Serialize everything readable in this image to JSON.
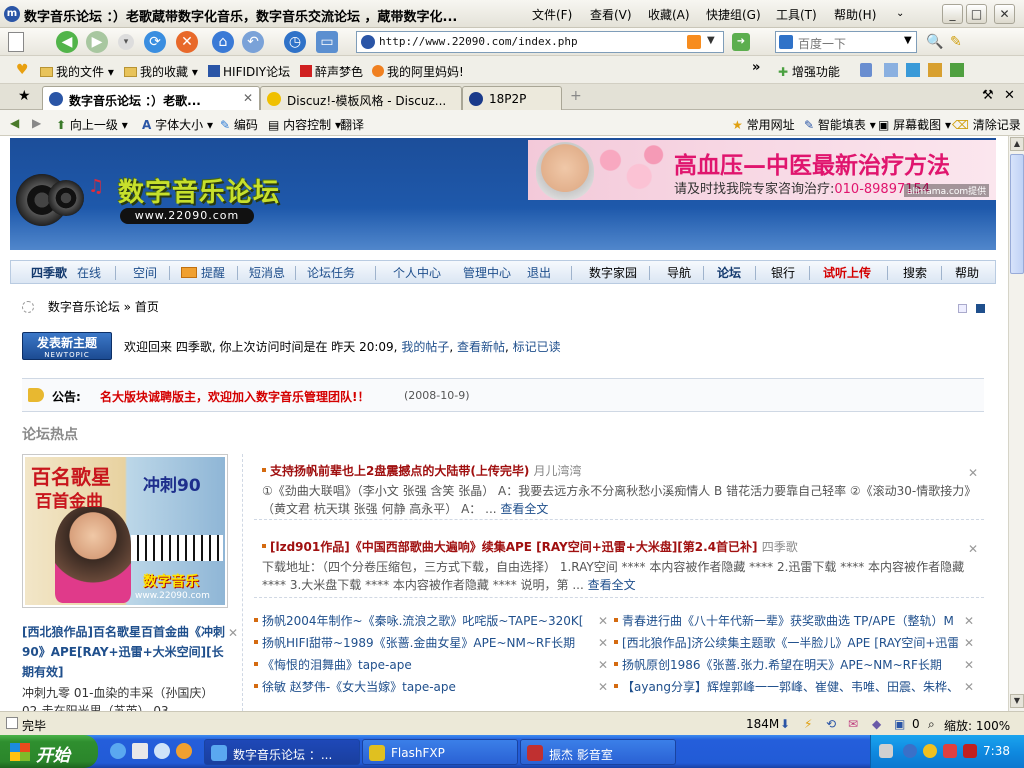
{
  "window": {
    "title": "数字音乐论坛 ：）老歌蔵带数字化音乐，数字音乐交流论坛 ，蔵带数字化...",
    "menus": [
      "文件(F)",
      "查看(V)",
      "收藏(A)",
      "快捷组(G)",
      "工具(T)",
      "帮助(H)"
    ],
    "controls": {
      "minimize": "_",
      "maximize": "□",
      "close": "✕"
    }
  },
  "toolbar": {
    "address": "http://www.22090.com/index.php",
    "search_placeholder": "百度一下"
  },
  "favorites": {
    "items": [
      "我的文件",
      "我的收藏",
      "HIFIDIY论坛",
      "醉声梦色",
      "我的阿里妈妈!"
    ],
    "right": [
      "增强功能"
    ]
  },
  "tabs": [
    {
      "label": "数字音乐论坛 ：）老歌...",
      "active": true
    },
    {
      "label": "Discuz!-模板风格 - Discuz...",
      "active": false
    },
    {
      "label": "18P2P",
      "active": false
    }
  ],
  "assist": {
    "left": [
      "向上一级",
      "字体大小",
      "编码",
      "内容控制",
      "翻译"
    ],
    "right": [
      "常用网址",
      "智能填表",
      "屏幕截图",
      "清除记录"
    ]
  },
  "site": {
    "logo_title": "数字音乐论坛",
    "logo_url": "www.22090.com",
    "ad": {
      "headline": "高血压—中医最新治疗方法",
      "sub_prefix": "请及时找我院专家咨询治疗:",
      "phone": "010-89897154",
      "provider": "alimama.com提供"
    },
    "nav_left": [
      {
        "label": "四季歌",
        "style": "bold"
      },
      {
        "label": "在线",
        "style": "link"
      },
      {
        "label": "空间",
        "style": "link"
      },
      {
        "label": "提醒",
        "style": "link"
      },
      {
        "label": "短消息",
        "style": "link"
      },
      {
        "label": "论坛任务",
        "style": "link"
      },
      {
        "label": "个人中心",
        "style": "link"
      },
      {
        "label": "管理中心",
        "style": "link"
      },
      {
        "label": "退出",
        "style": "link"
      }
    ],
    "nav_right": [
      {
        "label": "数字家园",
        "style": "black"
      },
      {
        "label": "导航",
        "style": "black"
      },
      {
        "label": "论坛",
        "style": "bold"
      },
      {
        "label": "银行",
        "style": "black"
      },
      {
        "label": "试听上传",
        "style": "red"
      },
      {
        "label": "搜索",
        "style": "black"
      },
      {
        "label": "帮助",
        "style": "black"
      }
    ],
    "breadcrumb": {
      "site": "数字音乐论坛",
      "sep": "»",
      "page": "首页"
    },
    "new_topic": {
      "cn": "发表新主题",
      "en": "NEWTOPIC"
    },
    "welcome": {
      "text": "欢迎回来  四季歌, 你上次访问时间是在  昨天 20:09,",
      "links": [
        "我的帖子",
        "查看新帖",
        "标记已读"
      ]
    },
    "announcement": {
      "label": "公告:",
      "message": "名大版块诚聘版主，欢迎加入数字音乐管理团队!！",
      "date": "(2008-10-9)"
    },
    "hot": {
      "title": "论坛热点",
      "image": {
        "title1": "百名歌星",
        "title2": "冲刺90",
        "brand": "数字音乐",
        "site": "www.22090.com",
        "caption": "百首金曲"
      },
      "link": "[西北狼作品]百名歌星百首金曲《冲刺90》APE[RAY+迅雷+大米空间][长期有效]",
      "desc": "冲刺九零  01-血染的丰采（孙国庆）  02-走在阳光里（苏芮）  03..."
    },
    "topics": [
      {
        "title": "支持扬帆前辈也上2盘震撼点的大陆带(上传完毕)",
        "author": "月儿湾湾",
        "body": "①《劲曲大联唱》（李小文 张强 含笑 张晶） A：我要去远方永不分离秋愁小溪痴情人 B 错花活力要靠自己轻率 ②《滚动30-情歌接力》（黄文君 杭天琪 张强 何静 高永平） A：",
        "more": "查看全文"
      },
      {
        "title": "[lzd901作品]《中国西部歌曲大遍响》续集APE [RAY空间+迅雷+大米盘][第2.4首已补]",
        "author": "四季歌",
        "body": "下载地址：（四个分卷压缩包，三方式下载，自由选择） 1.RAY空间 **** 本内容被作者隐藏 **** 2.迅雷下载 **** 本内容被作者隐藏 **** 3.大米盘下载 **** 本内容被作者隐藏 **** 说明，第",
        "more": "查看全文"
      }
    ],
    "list_left": [
      "扬帆2004年制作~《秦咏.流浪之歌》叱咤版~TAPE~320K[",
      "扬帆HIFI甜带~1989《张蔷.金曲女星》APE~NM~RF长期",
      "《悔恨的泪舞曲》tape-ape",
      "徐敏 赵梦伟-《女大当嫁》tape-ape"
    ],
    "list_right": [
      "青春进行曲《八十年代新一辈》获奖歌曲选 TP/APE（整轨）M",
      "[西北狼作品]济公续集主题歌《一半脸儿》APE [RAY空间+迅雷",
      "扬帆原创1986《张蔷.张力.希望在明天》APE~NM~RF长期",
      "【ayang分享】辉煌郭峰一一郭峰、崔健、韦唯、田震、朱桦、"
    ],
    "ellipsis": "..."
  },
  "status": {
    "text": "完毕",
    "memory": "184M",
    "count": "0",
    "zoom": "缩放: 100%"
  },
  "taskbar": {
    "start": "开始",
    "tasks": [
      "数字音乐论坛 ：...",
      "FlashFXP",
      "振杰 影音室"
    ],
    "clock": "7:38"
  },
  "colors": {
    "accent": "#1f4f8c",
    "header": "#1e58aa",
    "announce": "#d40000",
    "taskbar": "#245edb"
  }
}
